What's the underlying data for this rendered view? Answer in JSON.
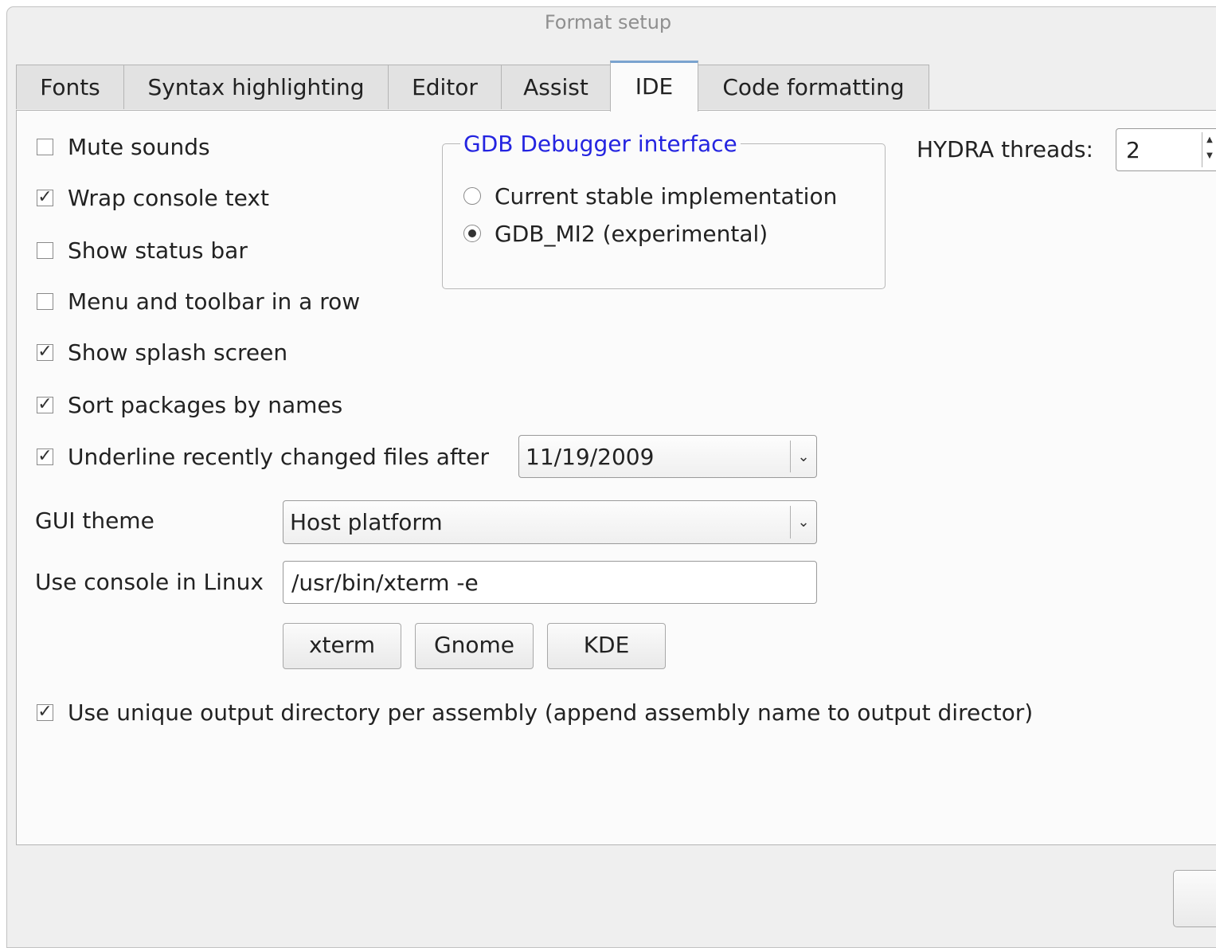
{
  "window": {
    "title": "Format setup"
  },
  "tabs": [
    {
      "label": "Fonts"
    },
    {
      "label": "Syntax highlighting"
    },
    {
      "label": "Editor"
    },
    {
      "label": "Assist"
    },
    {
      "label": "IDE",
      "active": true
    },
    {
      "label": "Code formatting"
    }
  ],
  "checkboxes": {
    "mute_sounds": {
      "label": "Mute sounds",
      "checked": false
    },
    "wrap_console": {
      "label": "Wrap console text",
      "checked": true
    },
    "show_status_bar": {
      "label": "Show status bar",
      "checked": false
    },
    "menu_toolbar_row": {
      "label": "Menu and toolbar in a row",
      "checked": false
    },
    "show_splash": {
      "label": "Show splash screen",
      "checked": true
    },
    "sort_packages": {
      "label": "Sort packages by names",
      "checked": true
    },
    "underline_recent": {
      "label": "Underline recently changed files after",
      "checked": true
    },
    "unique_output_dir": {
      "label": "Use unique output directory per assembly (append assembly name to output director)",
      "checked": true
    }
  },
  "check_mark": "☑",
  "underline_date": {
    "value": "11/19/2009"
  },
  "gdb": {
    "title": "GDB Debugger interface",
    "options": [
      {
        "label": "Current stable implementation",
        "selected": false
      },
      {
        "label": "GDB_MI2 (experimental)",
        "selected": true
      }
    ]
  },
  "hydra": {
    "label": "HYDRA threads:",
    "value": "2"
  },
  "gui_theme": {
    "label": "GUI theme",
    "value": "Host platform"
  },
  "console": {
    "label": "Use console in Linux",
    "value": "/usr/bin/xterm -e",
    "buttons": [
      {
        "label": "xterm"
      },
      {
        "label": "Gnome"
      },
      {
        "label": "KDE"
      }
    ]
  },
  "icons": {
    "dropdown": "chevron-down-icon",
    "spin": "spin-arrows-icon"
  },
  "colors": {
    "group_title": "#2424e0",
    "active_tab_accent": "#7aa3cf"
  }
}
